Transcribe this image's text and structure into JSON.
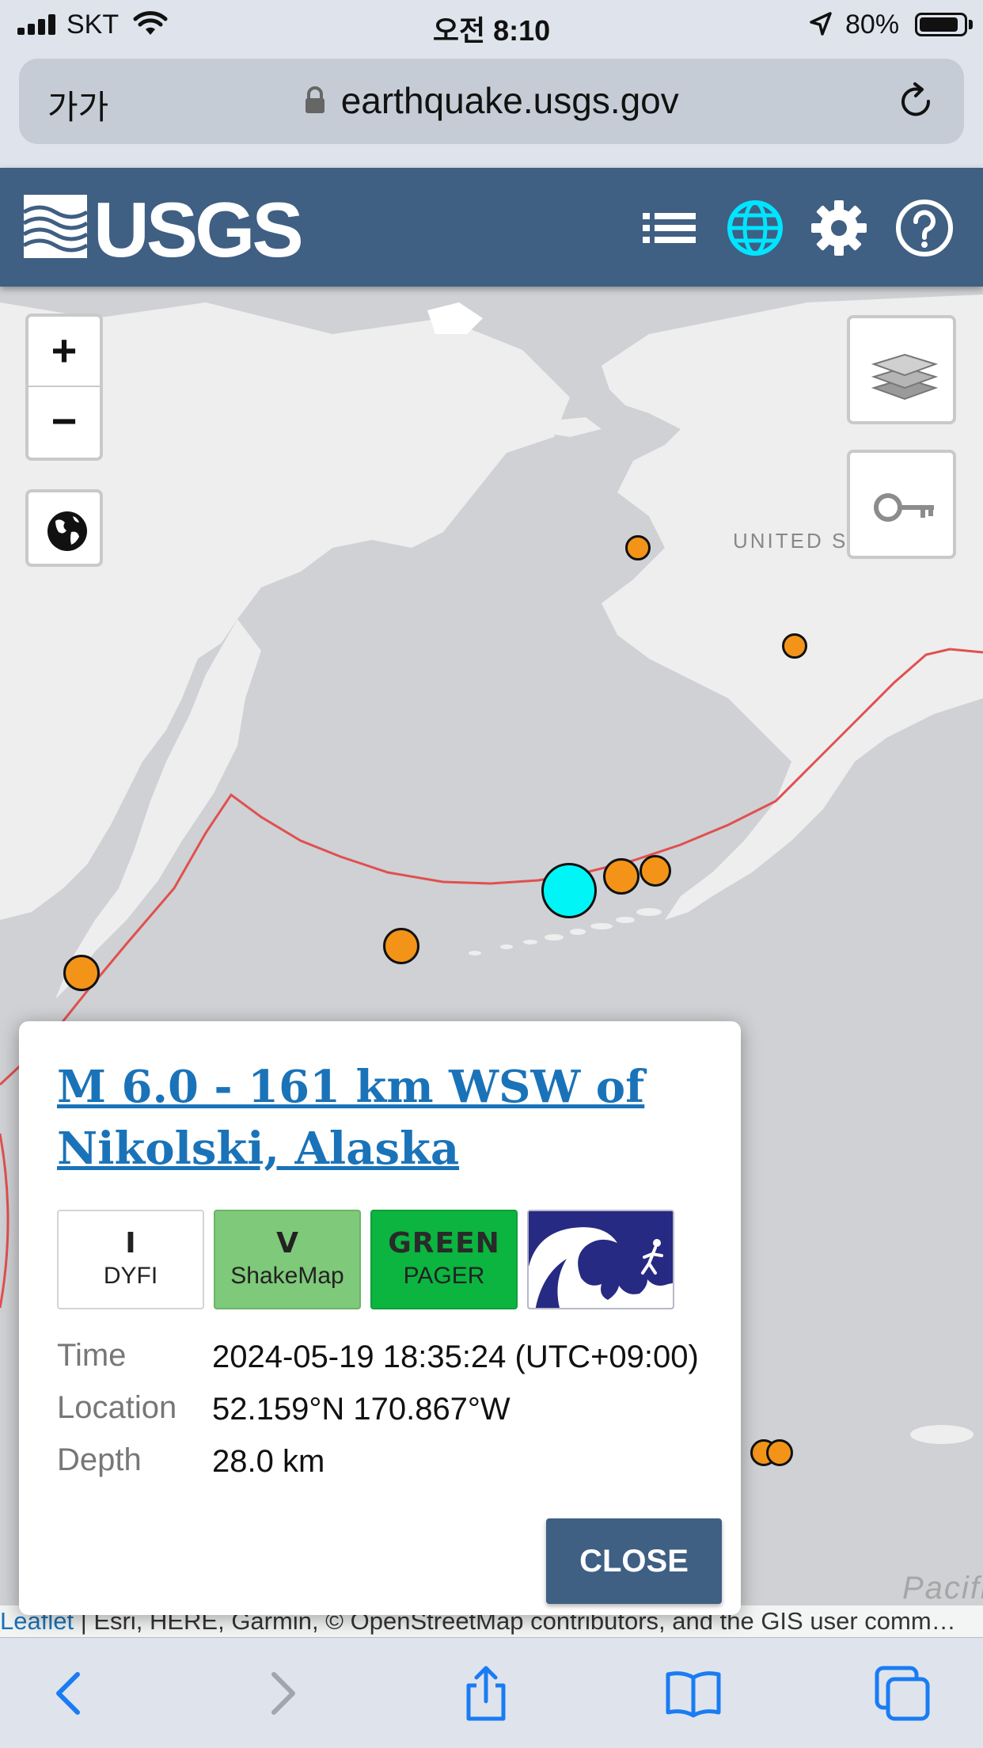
{
  "status_bar": {
    "carrier": "SKT",
    "time": "오전 8:10",
    "battery_percent": "80%",
    "battery_level": 0.8
  },
  "browser": {
    "text_size_button": "가가",
    "url": "earthquake.usgs.gov",
    "icons": [
      "lock-icon",
      "reload-icon"
    ]
  },
  "header": {
    "logo_text": "USGS",
    "icons": [
      "list-icon",
      "globe-icon",
      "gear-icon",
      "help-icon"
    ],
    "active_icon_color": "#00e5ff",
    "background_color": "#3f5f83"
  },
  "map": {
    "labels": {
      "country": "UNITED ST",
      "ocean": "Pacifi"
    },
    "controls": {
      "zoom_in": "+",
      "zoom_out": "−"
    },
    "fault_line_color": "#e05050",
    "earthquake_marker_color": "#f39419",
    "selected_marker_color": "#00f6f6"
  },
  "popup": {
    "title": "M 6.0 - 161 km WSW of Nikolski, Alaska",
    "badges": [
      {
        "level": "I",
        "name": "DYFI"
      },
      {
        "level": "V",
        "name": "ShakeMap"
      },
      {
        "level": "GREEN",
        "name": "PAGER"
      },
      {
        "icon": "tsunami-icon"
      }
    ],
    "details": [
      {
        "label": "Time",
        "value": "2024-05-19 18:35:24 (UTC+09:00)"
      },
      {
        "label": "Location",
        "value": "52.159°N 170.867°W"
      },
      {
        "label": "Depth",
        "value": "28.0 km"
      }
    ],
    "close_label": "CLOSE"
  },
  "attribution": {
    "leaflet": "Leaflet",
    "text": " | Esri, HERE, Garmin, © OpenStreetMap contributors, and the GIS user comm…"
  },
  "toolbar": {
    "icons": [
      "back-icon",
      "forward-icon",
      "share-icon",
      "bookmarks-icon",
      "tabs-icon"
    ]
  }
}
